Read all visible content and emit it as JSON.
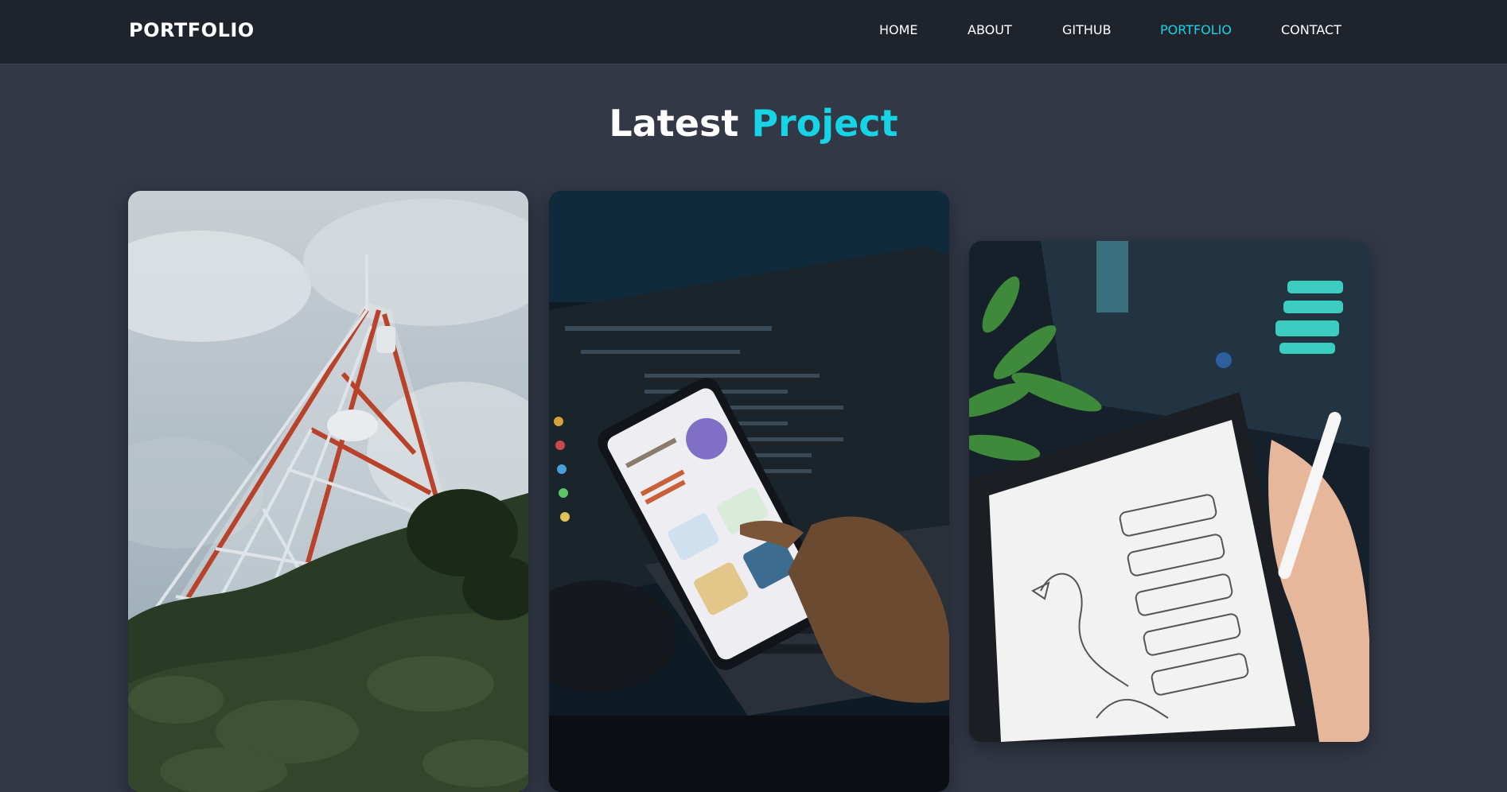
{
  "navbar": {
    "logo": "PORTFOLIO",
    "links": [
      {
        "label": "HOME",
        "active": false
      },
      {
        "label": "ABOUT",
        "active": false
      },
      {
        "label": "GITHUB",
        "active": false
      },
      {
        "label": "PORTFOLIO",
        "active": true
      },
      {
        "label": "CONTACT",
        "active": false
      }
    ]
  },
  "section": {
    "title_white": "Latest",
    "title_accent": "Project"
  },
  "projects": [
    {
      "image": "telecom-tower-photo"
    },
    {
      "image": "phone-coding-app-photo"
    },
    {
      "image": "tablet-wireframe-sketch-photo"
    }
  ],
  "colors": {
    "background": "#323846",
    "navbar": "#1f232b",
    "accent": "#16d3e6",
    "text": "#ffffff"
  }
}
